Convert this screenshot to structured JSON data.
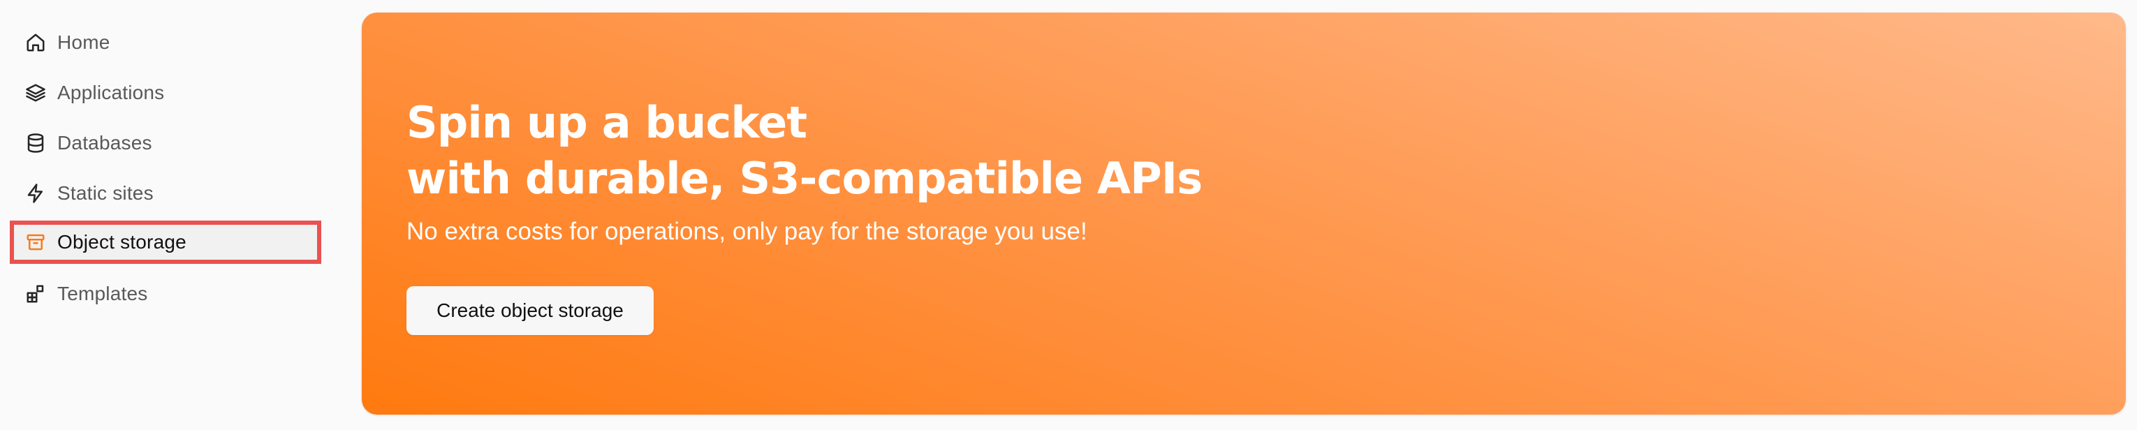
{
  "sidebar": {
    "items": [
      {
        "label": "Home",
        "icon": "home-icon",
        "active": false
      },
      {
        "label": "Applications",
        "icon": "layers-icon",
        "active": false
      },
      {
        "label": "Databases",
        "icon": "database-icon",
        "active": false
      },
      {
        "label": "Static sites",
        "icon": "lightning-icon",
        "active": false
      },
      {
        "label": "Object storage",
        "icon": "archive-icon",
        "active": true
      },
      {
        "label": "Templates",
        "icon": "blocks-icon",
        "active": false
      }
    ]
  },
  "banner": {
    "title_line1": "Spin up a bucket",
    "title_line2": "with durable, S3-compatible APIs",
    "subtitle": "No extra costs for operations, only pay for the storage you use!",
    "button_label": "Create object storage"
  },
  "colors": {
    "accent": "#ff7a0f",
    "highlight": "#ea5150"
  }
}
